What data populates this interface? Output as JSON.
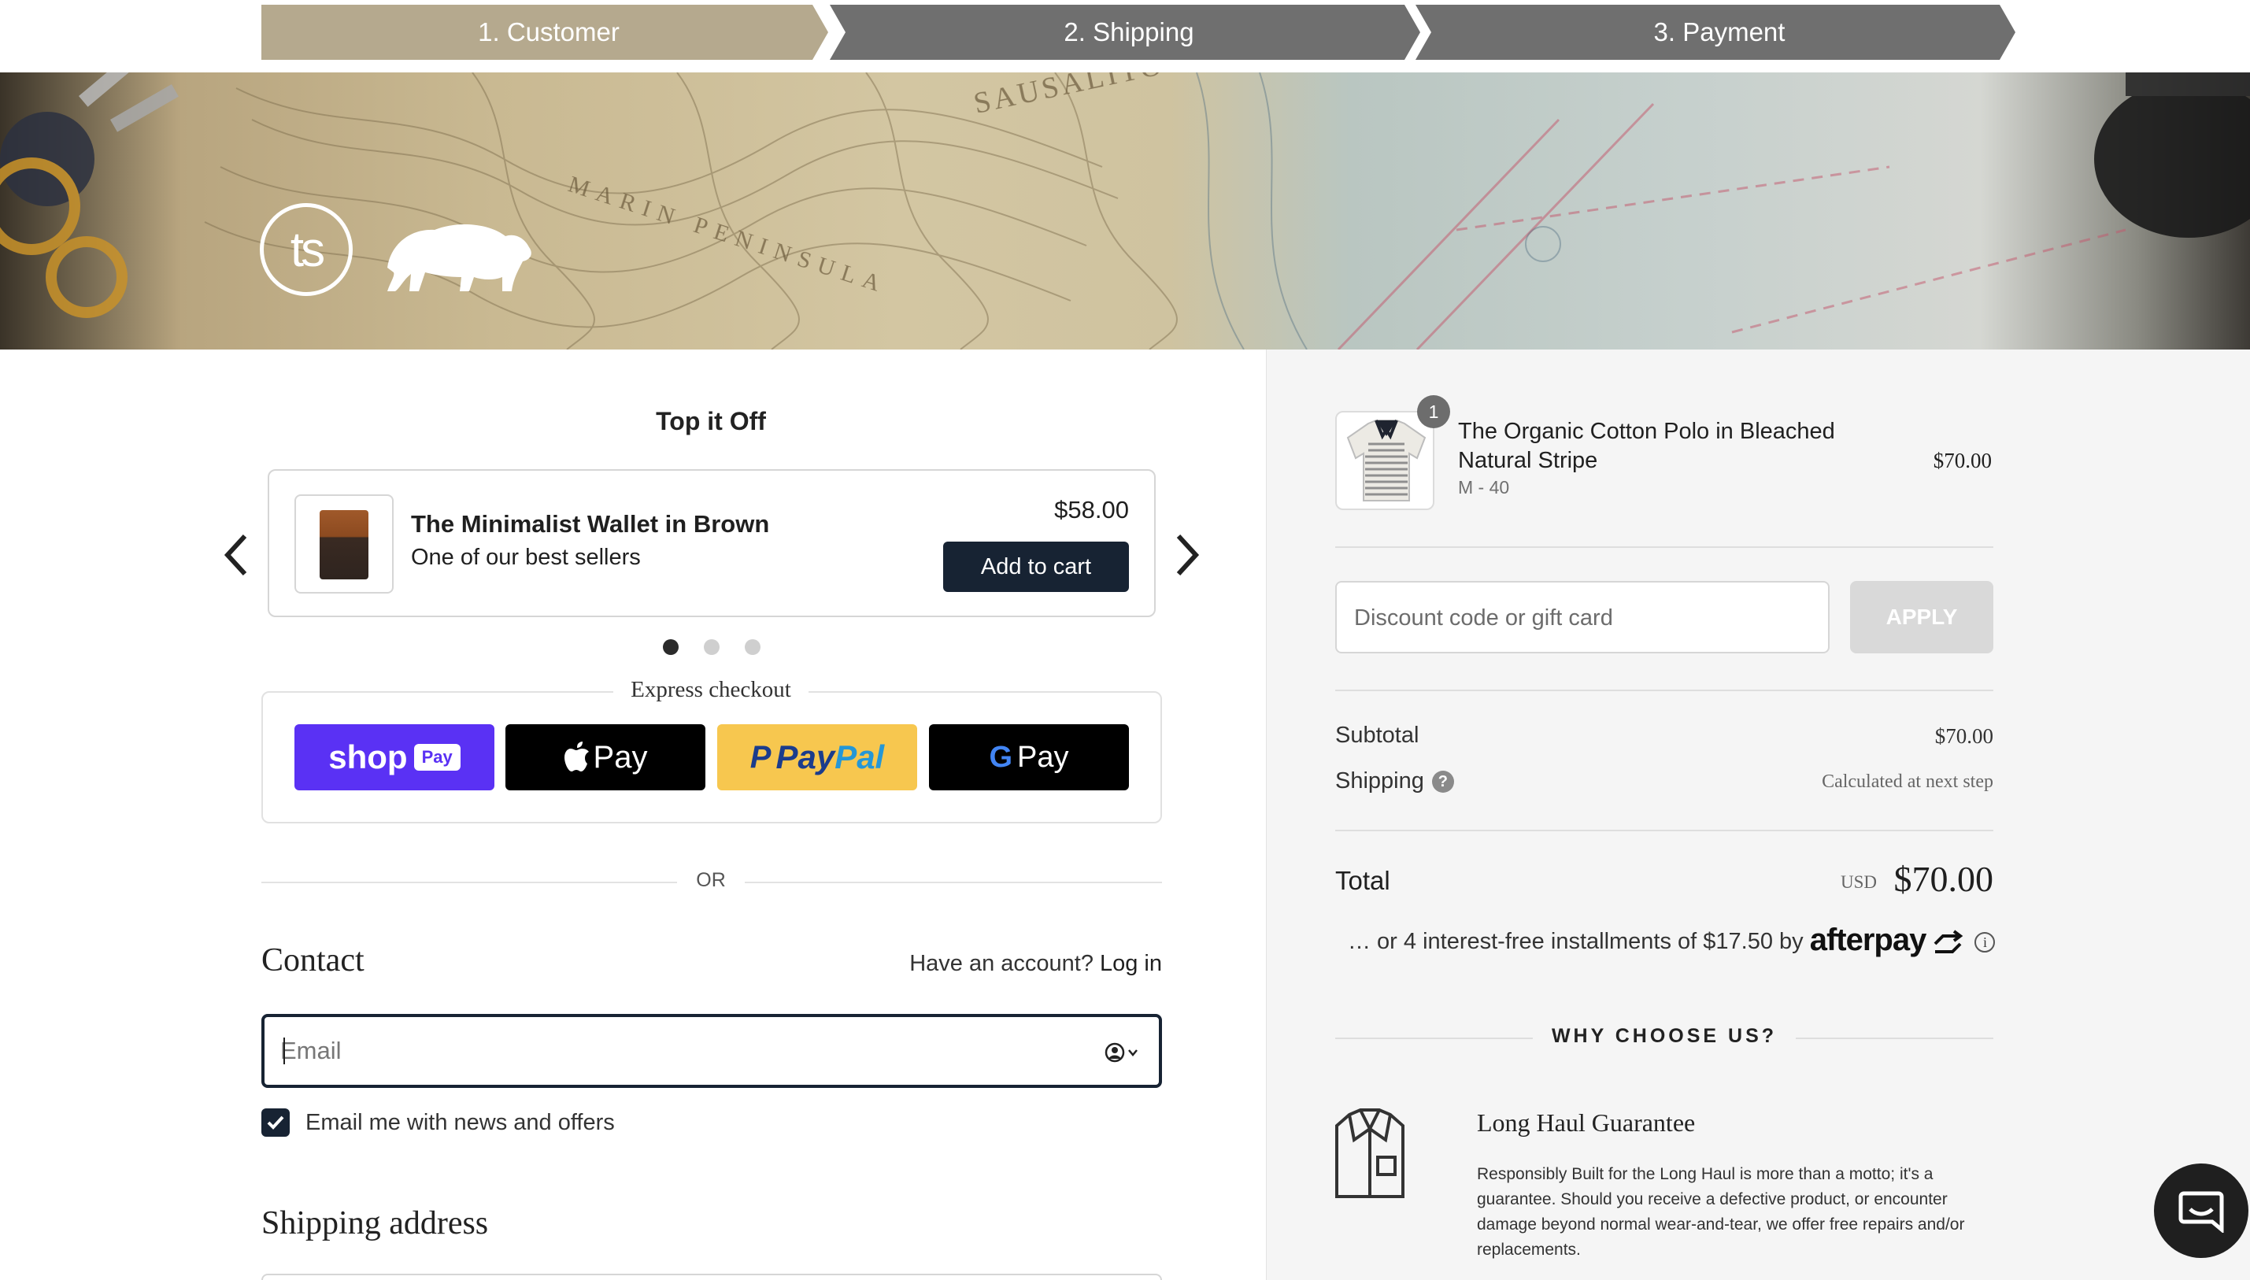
{
  "steps": [
    {
      "label": "1. Customer",
      "active": true
    },
    {
      "label": "2. Shipping",
      "active": false
    },
    {
      "label": "3. Payment",
      "active": false
    }
  ],
  "banner": {
    "logo_text": "ts",
    "map_label": "SAUSALITO",
    "map_region": "MARIN PENINSULA"
  },
  "upsell": {
    "heading": "Top it Off",
    "product_title": "The Minimalist Wallet in Brown",
    "product_subtitle": "One of our best sellers",
    "price": "$58.00",
    "add_button": "Add to cart",
    "prev_icon": "chevron-left-icon",
    "next_icon": "chevron-right-icon",
    "slides": 3,
    "active_slide": 1
  },
  "express": {
    "label": "Express checkout",
    "shop_pay": "shop",
    "shop_pay_badge": "Pay",
    "apple_pay": "Pay",
    "paypal_a": "Pay",
    "paypal_b": "Pal",
    "google_pay": "Pay"
  },
  "divider_or": "OR",
  "contact": {
    "heading": "Contact",
    "have_account": "Have an account?",
    "login_link": "Log in",
    "email_placeholder": "Email",
    "news_label": "Email me with news and offers",
    "news_checked": true
  },
  "shipping_heading": "Shipping address",
  "summary": {
    "item": {
      "name": "The Organic Cotton Polo in Bleached Natural Stripe",
      "variant": "M - 40",
      "price": "$70.00",
      "quantity": "1"
    },
    "discount_placeholder": "Discount code or gift card",
    "apply_button": "APPLY",
    "subtotal_label": "Subtotal",
    "subtotal_value": "$70.00",
    "shipping_label": "Shipping",
    "shipping_value": "Calculated at next step",
    "total_label": "Total",
    "total_currency": "USD",
    "total_value": "$70.00",
    "afterpay_text": "… or 4 interest-free installments of $17.50 by",
    "afterpay_brand": "afterpay",
    "why_heading": "WHY CHOOSE US?",
    "guarantee_title": "Long Haul Guarantee",
    "guarantee_body": "Responsibly Built for the Long Haul is more than a motto; it's a guarantee. Should you receive a defective product, or encounter damage beyond normal wear-and-tear, we offer free repairs and/or replacements."
  },
  "colors": {
    "step_active": "#b5a98e",
    "step_inactive": "#6f6f6f",
    "primary_dark": "#172333",
    "shop_pay": "#5a31f4",
    "paypal": "#f7c74f"
  }
}
